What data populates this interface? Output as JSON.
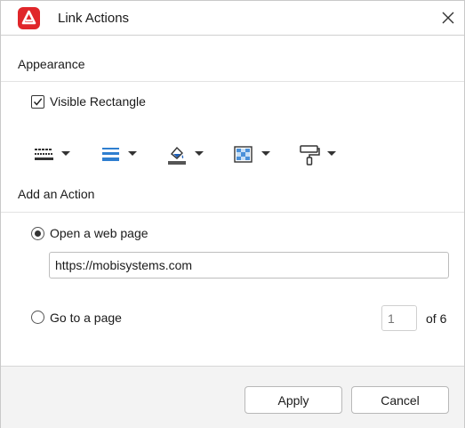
{
  "window": {
    "title": "Link Actions",
    "app_icon": "app-logo-icon",
    "close_icon": "close-icon",
    "accent_color": "#e0262a"
  },
  "appearance": {
    "section_title": "Appearance",
    "visible_rectangle": {
      "label": "Visible Rectangle",
      "checked": true
    },
    "tools": [
      {
        "name": "border-style-icon",
        "has_dropdown": true
      },
      {
        "name": "line-thickness-icon",
        "has_dropdown": true,
        "color": "#2f7fd0"
      },
      {
        "name": "border-color-icon",
        "has_dropdown": true,
        "color": "#1f5fb8"
      },
      {
        "name": "highlight-mode-icon",
        "has_dropdown": true
      },
      {
        "name": "paint-roller-icon",
        "has_dropdown": true
      }
    ]
  },
  "action": {
    "section_title": "Add an Action",
    "web_page": {
      "label": "Open a web page",
      "selected": true,
      "url": "https://mobisystems.com"
    },
    "go_to_page": {
      "label": "Go to a page",
      "selected": false,
      "page_placeholder": "1",
      "of_text": "of 6"
    }
  },
  "footer": {
    "apply_label": "Apply",
    "cancel_label": "Cancel"
  }
}
